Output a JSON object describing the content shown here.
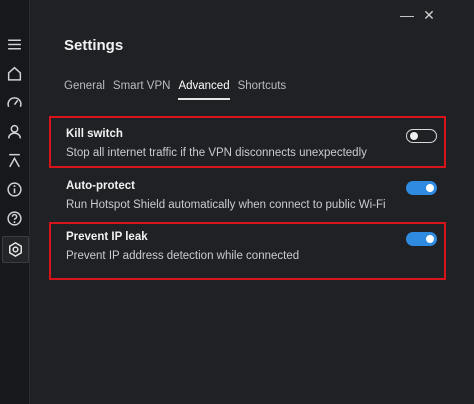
{
  "window": {
    "minimize_glyph": "—",
    "close_glyph": "✕"
  },
  "sidebar": {
    "icons": [
      "menu-icon",
      "home-icon",
      "speed-icon",
      "account-icon",
      "upgrade-icon",
      "info-icon",
      "help-icon",
      "settings-icon"
    ]
  },
  "page": {
    "title": "Settings"
  },
  "tabs": [
    {
      "label": "General",
      "active": false
    },
    {
      "label": "Smart VPN",
      "active": false
    },
    {
      "label": "Advanced",
      "active": true
    },
    {
      "label": "Shortcuts",
      "active": false
    }
  ],
  "settings": [
    {
      "title": "Kill switch",
      "description": "Stop all internet traffic if the VPN disconnects unexpectedly",
      "enabled": false
    },
    {
      "title": "Auto-protect",
      "description": "Run Hotspot Shield automatically when connect to public Wi-Fi",
      "enabled": true
    },
    {
      "title": "Prevent IP leak",
      "description": "Prevent IP address detection while connected",
      "enabled": true
    }
  ],
  "colors": {
    "background": "#1f2125",
    "sidebar": "#17181b",
    "toggle_on": "#2f8be0",
    "highlight": "#d8141b"
  }
}
